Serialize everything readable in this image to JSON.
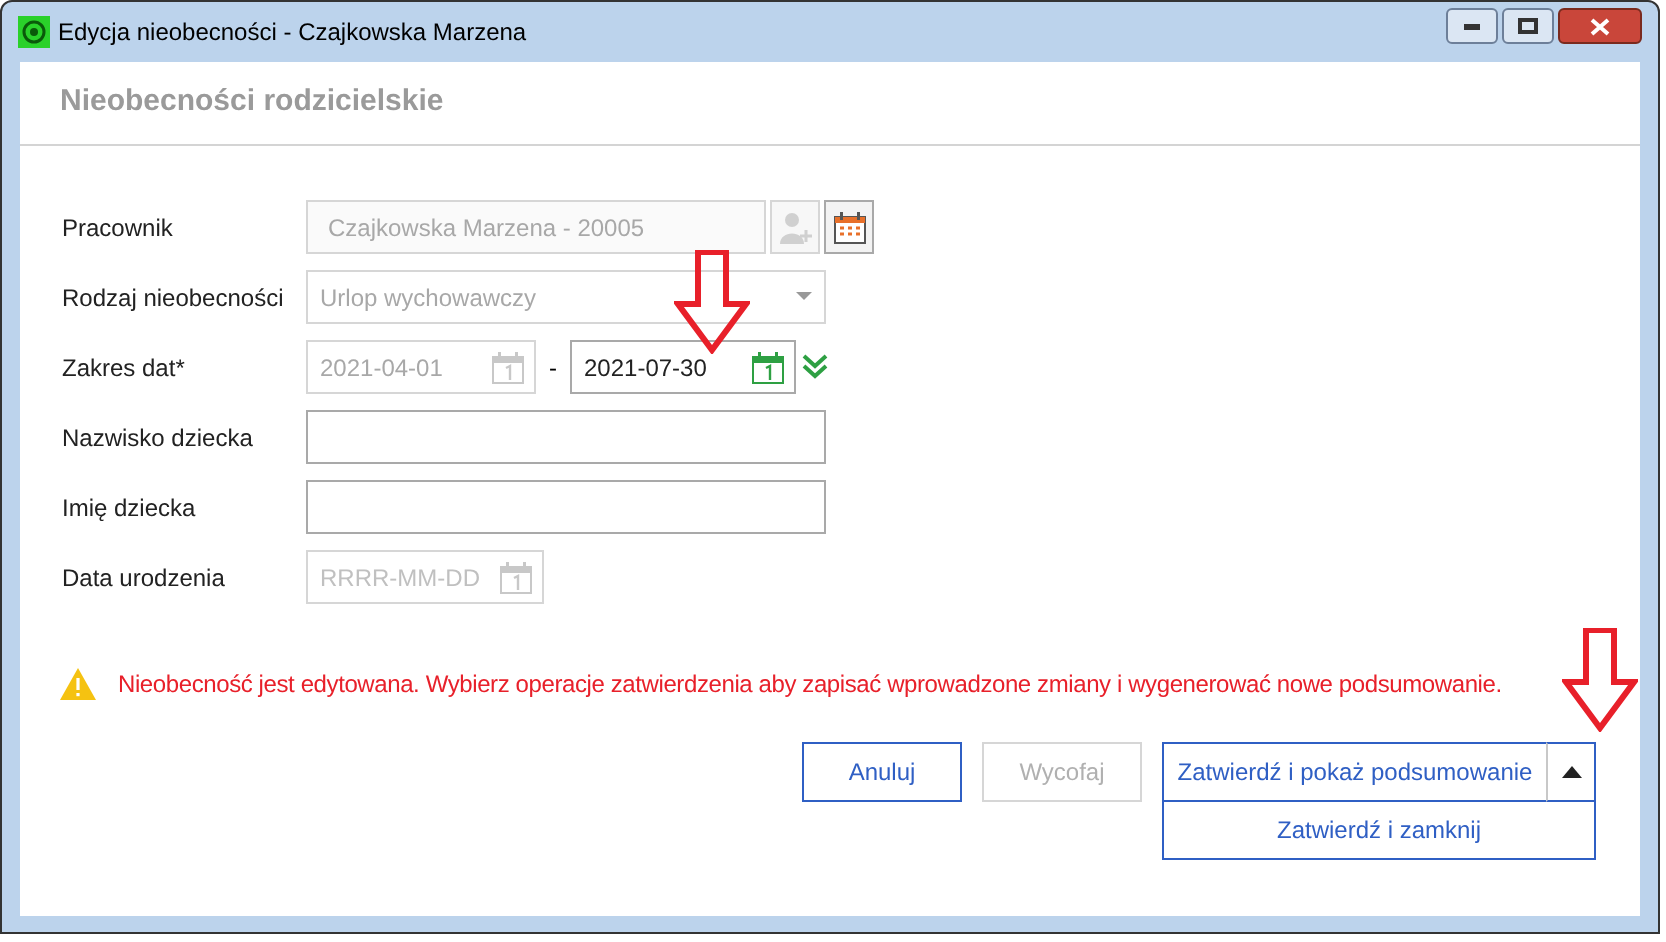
{
  "window": {
    "title": "Edycja nieobecności - Czajkowska Marzena"
  },
  "header": "Nieobecności rodzicielskie",
  "fields": [
    {
      "kind": "employee",
      "label": "Pracownik",
      "value": "Czajkowska Marzena - 20005",
      "disabled": true
    },
    {
      "kind": "select",
      "label": "Rodzaj nieobecności",
      "value": "Urlop wychowawczy",
      "disabled": true
    },
    {
      "kind": "range",
      "label": "Zakres dat*",
      "from": {
        "value": "2021-04-01",
        "disabled": true
      },
      "separator": "-",
      "to": {
        "value": "2021-07-30",
        "disabled": false
      }
    },
    {
      "kind": "text",
      "label": "Nazwisko dziecka",
      "disabled": false
    },
    {
      "kind": "text",
      "label": "Imię dziecka",
      "disabled": false
    },
    {
      "kind": "date",
      "label": "Data urodzenia",
      "placeholder": "RRRR-MM-DD",
      "disabled": true
    }
  ],
  "warning": "Nieobecność jest edytowana. Wybierz operacje zatwierdzenia aby zapisać wprowadzone zmiany i wygenerować nowe podsumowanie.",
  "buttons": [
    {
      "label": "Anuluj",
      "disabled": false
    },
    {
      "label": "Wycofaj",
      "disabled": true
    }
  ],
  "split_button": {
    "label": "Zatwierdź i pokaż podsumowanie",
    "expanded": true,
    "menu": [
      "Zatwierdź i zamknij"
    ]
  }
}
